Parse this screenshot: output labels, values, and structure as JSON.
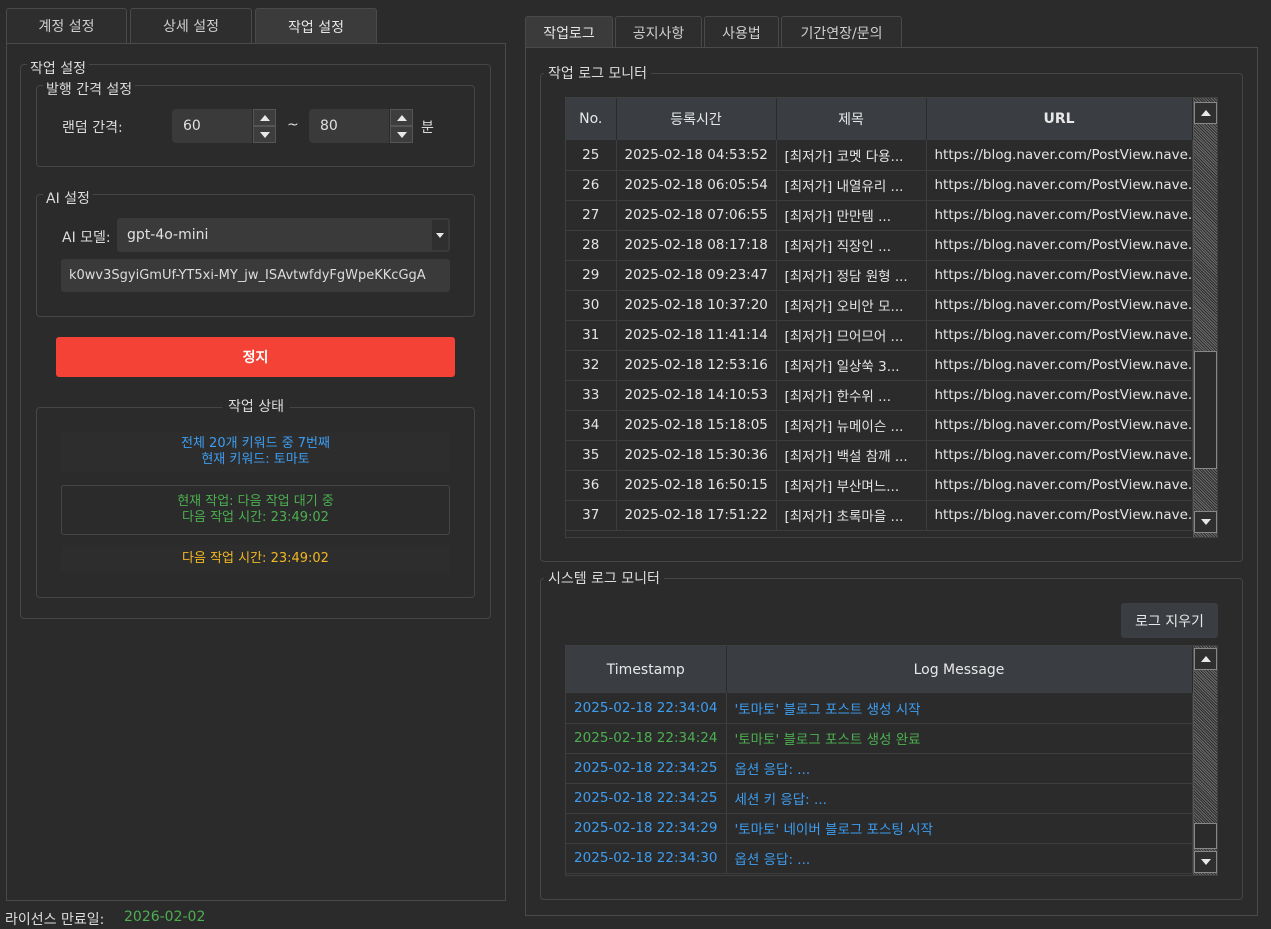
{
  "left_tabs": [
    "계정 설정",
    "상세 설정",
    "작업 설정"
  ],
  "right_tabs": [
    "작업로그",
    "공지사항",
    "사용법",
    "기간연장/문의"
  ],
  "work_settings": {
    "group_title": "작업 설정",
    "interval": {
      "title": "발행 간격 설정",
      "label": "랜덤 간격:",
      "min": "60",
      "sep": "~",
      "max": "80",
      "unit": "분"
    },
    "ai": {
      "title": "AI 설정",
      "model_label": "AI 모델:",
      "model_value": "gpt-4o-mini",
      "api_key": "k0wv3SgyiGmUf-YT5xi-MY_jw_ISAvtwfdyFgWpeKKcGgA"
    },
    "stop_label": "정지",
    "status": {
      "title": "작업 상태",
      "progress_line1": "전체 20개 키워드 중 7번째",
      "progress_line2": "현재 키워드: 토마토",
      "current_line1": "현재 작업: 다음 작업 대기 중",
      "current_line2": "다음 작업 시간: 23:49:02",
      "next_time": "다음 작업 시간: 23:49:02"
    }
  },
  "license": {
    "label": "라이선스 만료일:",
    "date": "2026-02-02"
  },
  "job_log": {
    "title": "작업 로그 모니터",
    "headers": [
      "No.",
      "등록시간",
      "제목",
      "URL"
    ],
    "rows": [
      [
        "25",
        "2025-02-18 04:53:52",
        "[최저가] 코멧 다용...",
        "https://blog.naver.com/PostView.nave..."
      ],
      [
        "26",
        "2025-02-18 06:05:54",
        "[최저가] 내열유리 ...",
        "https://blog.naver.com/PostView.nave..."
      ],
      [
        "27",
        "2025-02-18 07:06:55",
        "[최저가] 만만템 ...",
        "https://blog.naver.com/PostView.nave..."
      ],
      [
        "28",
        "2025-02-18 08:17:18",
        "[최저가] 직장인 ...",
        "https://blog.naver.com/PostView.nave..."
      ],
      [
        "29",
        "2025-02-18 09:23:47",
        "[최저가] 정담 원형 ...",
        "https://blog.naver.com/PostView.nave..."
      ],
      [
        "30",
        "2025-02-18 10:37:20",
        "[최저가] 오비안 모...",
        "https://blog.naver.com/PostView.nave..."
      ],
      [
        "31",
        "2025-02-18 11:41:14",
        "[최저가] 므어므어 ...",
        "https://blog.naver.com/PostView.nave..."
      ],
      [
        "32",
        "2025-02-18 12:53:16",
        "[최저가] 일상쑥 3...",
        "https://blog.naver.com/PostView.nave..."
      ],
      [
        "33",
        "2025-02-18 14:10:53",
        "[최저가] 한수위 ...",
        "https://blog.naver.com/PostView.nave..."
      ],
      [
        "34",
        "2025-02-18 15:18:05",
        "[최저가] 뉴메이슨 ...",
        "https://blog.naver.com/PostView.nave..."
      ],
      [
        "35",
        "2025-02-18 15:30:36",
        "[최저가] 백설 참깨 ...",
        "https://blog.naver.com/PostView.nave..."
      ],
      [
        "36",
        "2025-02-18 16:50:15",
        "[최저가] 부산며느...",
        "https://blog.naver.com/PostView.nave..."
      ],
      [
        "37",
        "2025-02-18 17:51:22",
        "[최저가] 초록마을 ...",
        "https://blog.naver.com/PostView.nave..."
      ]
    ]
  },
  "system_log": {
    "title": "시스템 로그 모니터",
    "clear_label": "로그 지우기",
    "headers": [
      "Timestamp",
      "Log Message"
    ],
    "rows": [
      {
        "time": "2025-02-18 22:34:04",
        "msg": "'토마토' 블로그 포스트 생성 시작",
        "level": "info"
      },
      {
        "time": "2025-02-18 22:34:24",
        "msg": "'토마토' 블로그 포스트 생성 완료",
        "level": "success"
      },
      {
        "time": "2025-02-18 22:34:25",
        "msg": "옵션 응답: ...",
        "level": "info"
      },
      {
        "time": "2025-02-18 22:34:25",
        "msg": "세션 키 응답: ...",
        "level": "info"
      },
      {
        "time": "2025-02-18 22:34:29",
        "msg": "'토마토' 네이버 블로그 포스팅 시작",
        "level": "info"
      },
      {
        "time": "2025-02-18 22:34:30",
        "msg": "옵션 응답: ...",
        "level": "info"
      }
    ]
  },
  "colors": {
    "info": "#3d9df0",
    "success": "#4caf50",
    "warning": "#f2b824",
    "stop": "#f44336"
  }
}
